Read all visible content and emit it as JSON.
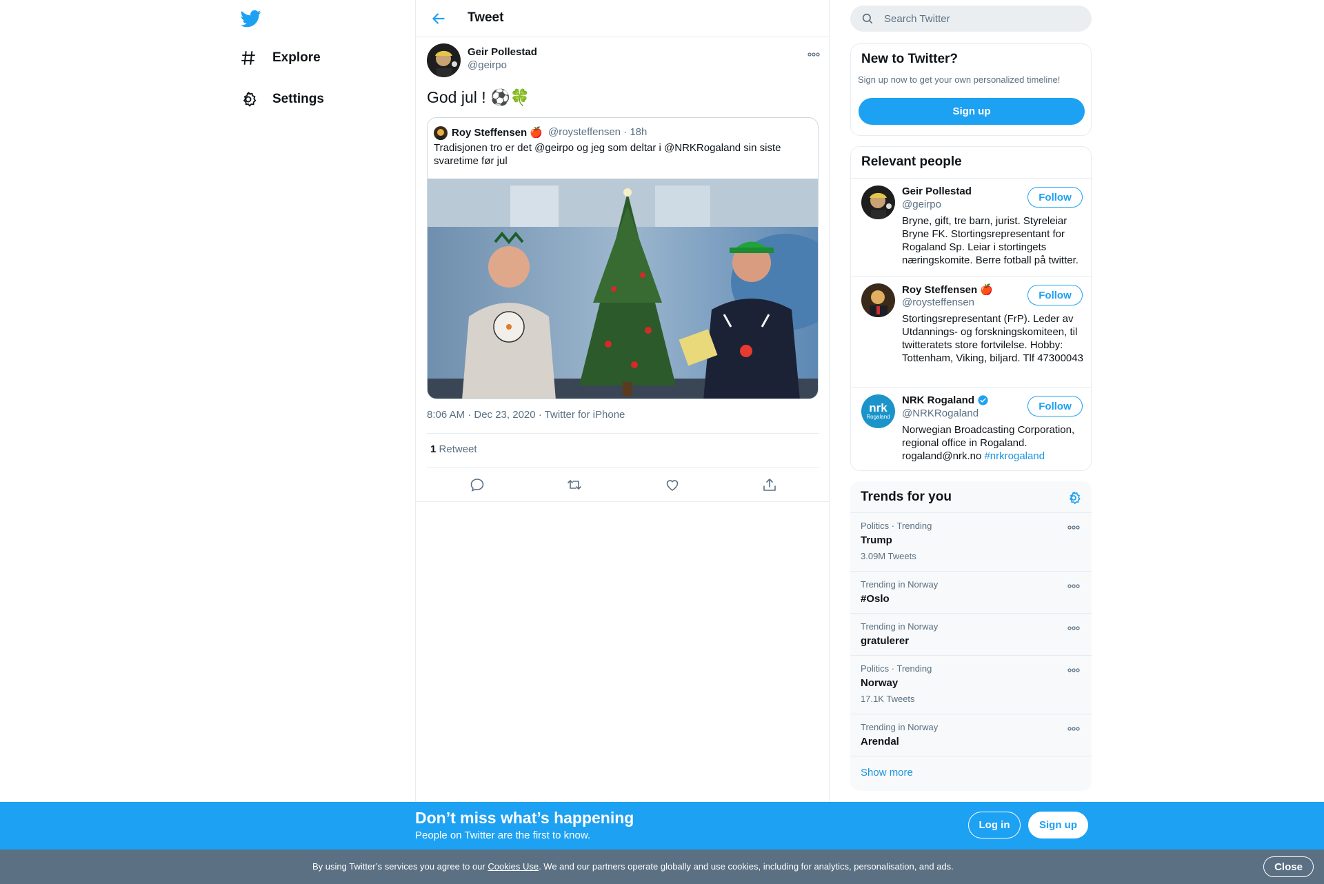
{
  "nav": {
    "logo_icon": "twitter-bird-icon",
    "items": [
      {
        "label": "Explore",
        "icon": "hashtag-icon"
      },
      {
        "label": "Settings",
        "icon": "gear-icon"
      }
    ]
  },
  "header": {
    "title": "Tweet"
  },
  "tweet": {
    "author_name": "Geir Pollestad",
    "author_handle": "@geirpo",
    "text": "God jul ! ⚽️🍀",
    "quoted": {
      "name": "Roy Steffensen",
      "name_emoji": "🍎",
      "handle_time": "@roysteffensen · 18h",
      "text": "Tradisjonen tro er det @geirpo og jeg som deltar i @NRKRogaland sin siste svaretime før jul"
    },
    "meta": "8:06 AM · Dec 23, 2020 · Twitter for iPhone",
    "retweet_count": "1",
    "retweet_label": "Retweet",
    "actions": [
      "reply-icon",
      "retweet-icon",
      "like-icon",
      "share-icon"
    ]
  },
  "search": {
    "placeholder": "Search Twitter"
  },
  "new_to_twitter": {
    "title": "New to Twitter?",
    "subtitle": "Sign up now to get your own personalized timeline!",
    "button": "Sign up"
  },
  "relevant_people": {
    "title": "Relevant people",
    "follow_label": "Follow",
    "people": [
      {
        "name": "Geir Pollestad",
        "handle": "@geirpo",
        "bio": "Bryne, gift, tre barn, jurist. Styreleiar Bryne FK. Stortingsrepresentant for Rogaland Sp. Leiar i stortingets næringskomite. Berre fotball på twitter."
      },
      {
        "name": "Roy Steffensen",
        "name_emoji": "🍎",
        "handle": "@roysteffensen",
        "bio": "Stortingsrepresentant (FrP). Leder av Utdannings- og forskningskomiteen, til twitteratets store fortvilelse. Hobby: Tottenham, Viking, biljard. Tlf 47300043"
      },
      {
        "name": "NRK Rogaland",
        "verified": true,
        "handle": "@NRKRogaland",
        "bio": "Norwegian Broadcasting Corporation, regional office in Rogaland. rogaland@nrk.no ",
        "bio_link": "#nrkrogaland",
        "avatar_text": "nrk",
        "avatar_sub": "Rogaland"
      }
    ]
  },
  "trends": {
    "title": "Trends for you",
    "items": [
      {
        "context": "Politics · Trending",
        "name": "Trump",
        "count": "3.09M Tweets"
      },
      {
        "context": "Trending in Norway",
        "name": "#Oslo",
        "count": ""
      },
      {
        "context": "Trending in Norway",
        "name": "gratulerer",
        "count": ""
      },
      {
        "context": "Politics · Trending",
        "name": "Norway",
        "count": "17.1K Tweets"
      },
      {
        "context": "Trending in Norway",
        "name": "Arendal",
        "count": ""
      }
    ],
    "show_more": "Show more"
  },
  "banner": {
    "title": "Don’t miss what’s happening",
    "subtitle": "People on Twitter are the first to know.",
    "login": "Log in",
    "signup": "Sign up"
  },
  "cookie": {
    "before": "By using Twitter’s services you agree to our ",
    "link": "Cookies Use",
    "after": ". We and our partners operate globally and use cookies, including for analytics, personalisation, and ads.",
    "close": "Close"
  },
  "colors": {
    "accent": "#1da1f2",
    "cookie_bg": "#5b7083",
    "border": "#e6ecf0"
  }
}
